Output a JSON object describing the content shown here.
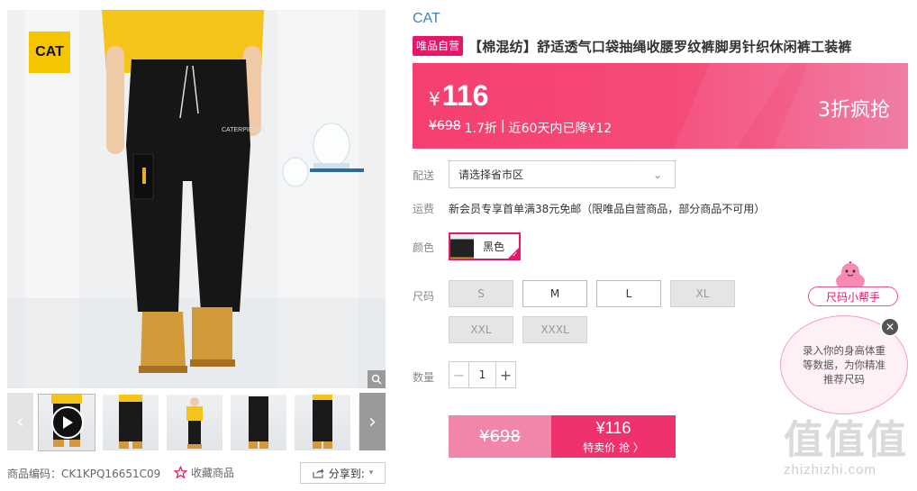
{
  "brand": "CAT",
  "product": {
    "badge": "唯品自营",
    "title": "【棉混纺】舒适透气口袋抽绳收腰罗纹裤脚男针织休闲裤工装裤"
  },
  "gallery": {
    "logo_text": "CAT",
    "thumbnail_count": 6
  },
  "price": {
    "currency": "¥",
    "current": "116",
    "original": "¥698",
    "discount": "1.7折",
    "separator": "|",
    "history": "近60天内已降¥12",
    "promo_label": "3折疯抢"
  },
  "delivery": {
    "label": "配送",
    "placeholder": "请选择省市区"
  },
  "shipping": {
    "label": "运费",
    "text": "新会员专享首单满38元免邮（限唯品自营商品，部分商品不可用）"
  },
  "color": {
    "label": "颜色",
    "selected": "黑色"
  },
  "size": {
    "label": "尺码",
    "options": [
      {
        "label": "S",
        "available": false
      },
      {
        "label": "M",
        "available": true
      },
      {
        "label": "L",
        "available": true
      },
      {
        "label": "XL",
        "available": false
      },
      {
        "label": "XXL",
        "available": false
      },
      {
        "label": "XXXL",
        "available": false
      }
    ]
  },
  "quantity": {
    "label": "数量",
    "value": "1",
    "minus": "−",
    "plus": "+"
  },
  "buy": {
    "original": "¥698",
    "price": "¥116",
    "cta": "特卖价 抢 〉"
  },
  "size_helper": {
    "label": "尺码小帮手",
    "bubble": "录入你的身高体重等数据，为你精准推荐尺码"
  },
  "footer": {
    "sku": "商品编码：CK1KPQ16651C09",
    "favorite": "收藏商品",
    "share": "分享到:"
  },
  "watermark": {
    "mark": "值值值",
    "url": "zhizhizhi.com"
  },
  "colors": {
    "accent": "#e8156a",
    "price_band": "#f54b79",
    "brand_link": "#3d80c8"
  }
}
